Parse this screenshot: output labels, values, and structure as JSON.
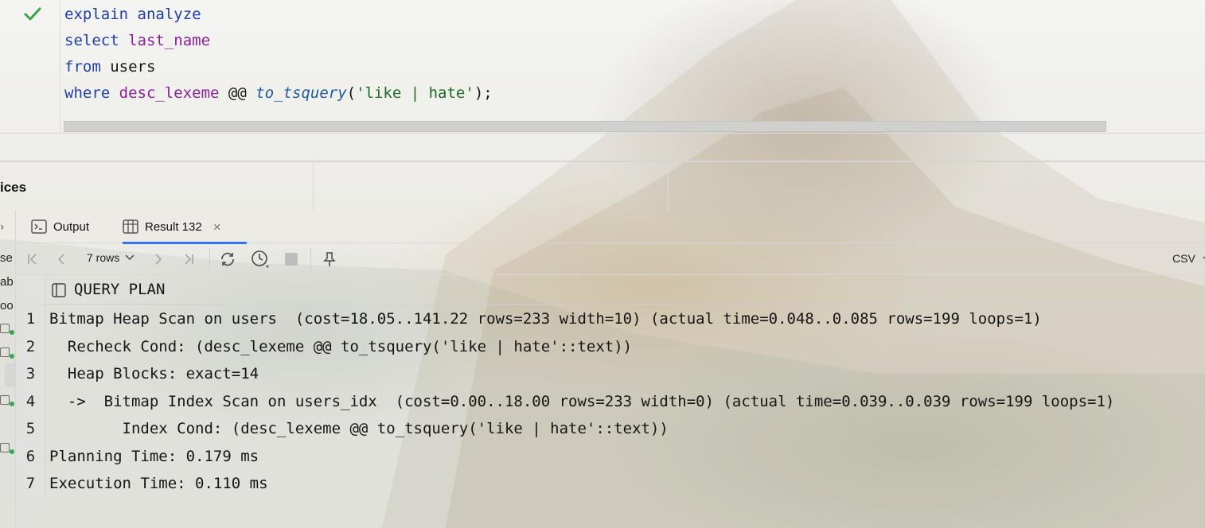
{
  "editor": {
    "lines": [
      [
        {
          "cls": "kw",
          "text": "explain analyze"
        }
      ],
      [
        {
          "cls": "kw",
          "text": "select "
        },
        {
          "cls": "col",
          "text": "last_name"
        }
      ],
      [
        {
          "cls": "kw",
          "text": "from "
        },
        {
          "cls": "plain",
          "text": "users"
        }
      ],
      [
        {
          "cls": "kw",
          "text": "where "
        },
        {
          "cls": "col",
          "text": "desc_lexeme"
        },
        {
          "cls": "plain",
          "text": " @@ "
        },
        {
          "cls": "fn",
          "text": "to_tsquery"
        },
        {
          "cls": "plain",
          "text": "("
        },
        {
          "cls": "str",
          "text": "'like | hate'"
        },
        {
          "cls": "plain",
          "text": ");"
        }
      ]
    ],
    "status_icon": "check-icon",
    "status_color": "#3aa350"
  },
  "services": {
    "title": "ices",
    "left_strip": {
      "labels": [
        "se",
        "ab",
        "oo"
      ]
    }
  },
  "tabs": [
    {
      "label": "Output",
      "icon": "console-icon",
      "active": false
    },
    {
      "label": "Result 132",
      "icon": "table-icon",
      "active": true,
      "closable": true
    }
  ],
  "toolbar": {
    "rows_label": "7 rows",
    "export_format": "CSV"
  },
  "result": {
    "column": "QUERY PLAN",
    "rows": [
      {
        "n": "1",
        "text": "Bitmap Heap Scan on users  (cost=18.05..141.22 rows=233 width=10) (actual time=0.048..0.085 rows=199 loops=1)"
      },
      {
        "n": "2",
        "text": "  Recheck Cond: (desc_lexeme @@ to_tsquery('like | hate'::text))"
      },
      {
        "n": "3",
        "text": "  Heap Blocks: exact=14"
      },
      {
        "n": "4",
        "text": "  ->  Bitmap Index Scan on users_idx  (cost=0.00..18.00 rows=233 width=0) (actual time=0.039..0.039 rows=199 loops=1)"
      },
      {
        "n": "5",
        "text": "        Index Cond: (desc_lexeme @@ to_tsquery('like | hate'::text))"
      },
      {
        "n": "6",
        "text": "Planning Time: 0.179 ms"
      },
      {
        "n": "7",
        "text": "Execution Time: 0.110 ms"
      }
    ]
  },
  "colors": {
    "accent": "#3574f0",
    "keyword": "#1f3fa8",
    "identifier": "#8a1e97",
    "function": "#1d5aa0",
    "string": "#1f6b1f",
    "status_dot": "#32a852"
  }
}
